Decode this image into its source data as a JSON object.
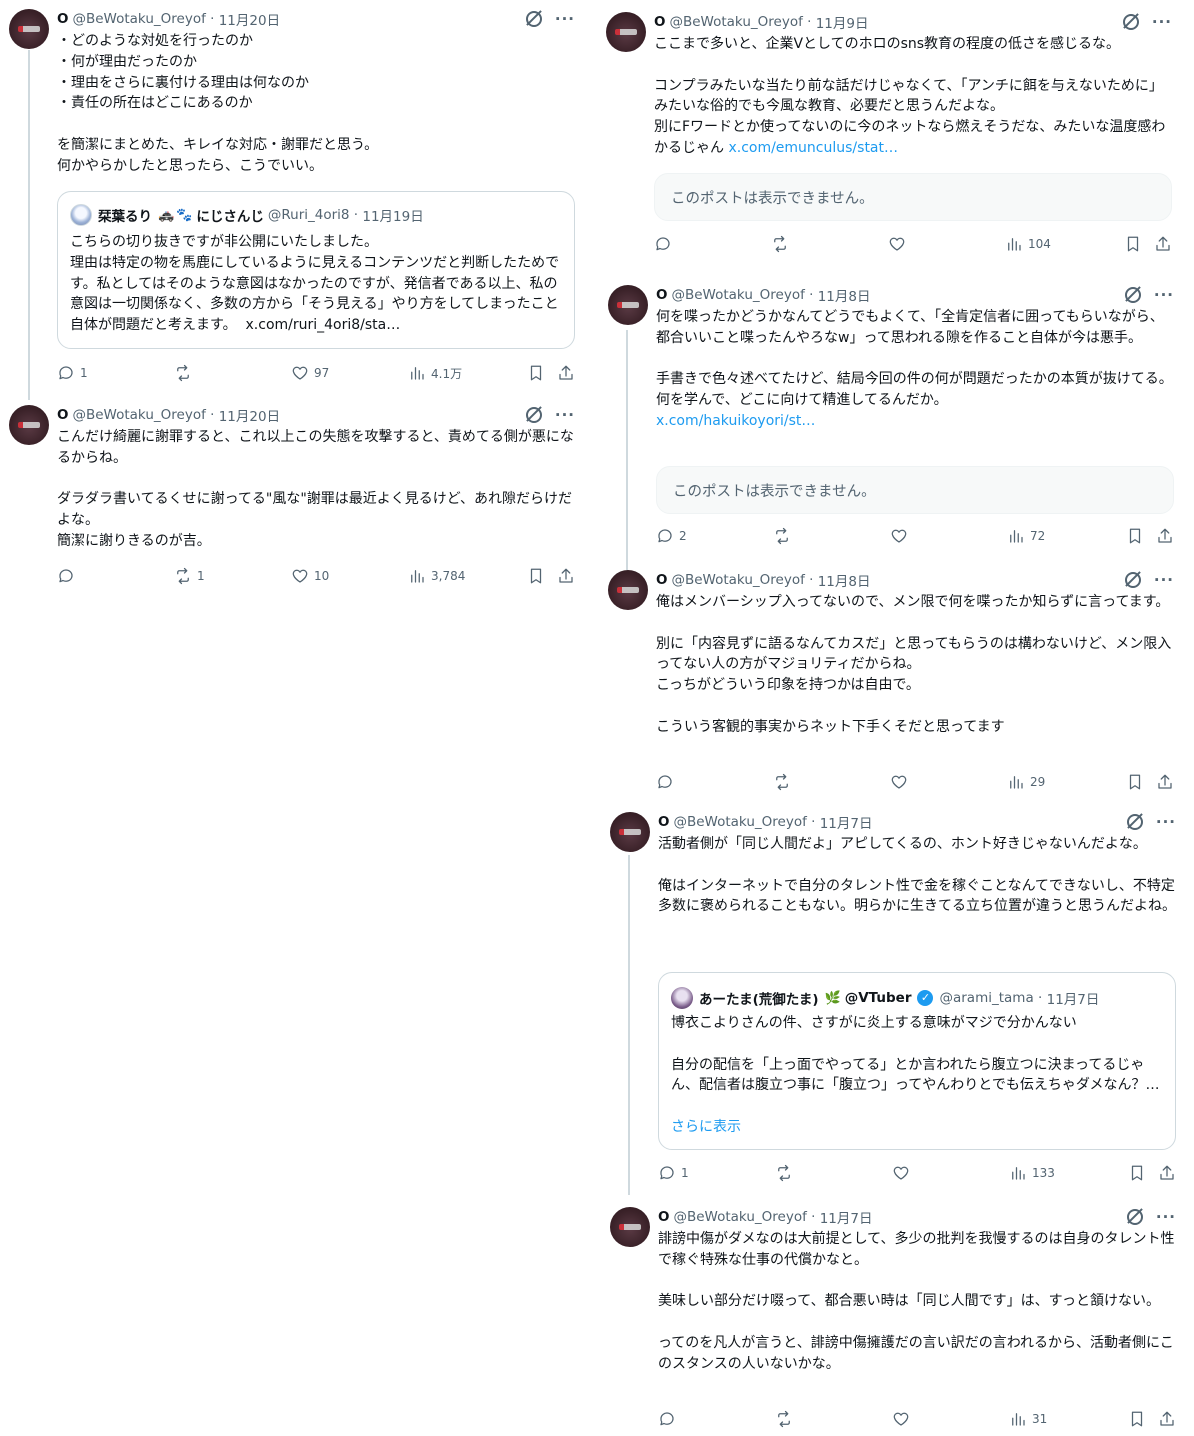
{
  "tweets": [
    {
      "id": "t1",
      "name": "O",
      "handle": "@BeWotaku_Oreyof",
      "date": "11月20日",
      "text": "・どのような対処を行ったのか\n・何が理由だったのか\n・理由をさらに裏付ける理由は何なのか\n・責任の所在はどこにあるのか\n\nを簡潔にまとめた、キレイな対応・謝罪だと思う。\n何かやらかしたと思ったら、こうでいい。",
      "quote": {
        "name": "栞葉るり",
        "name_suffix": "にじさんじ",
        "handle": "@Ruri_4ori8",
        "date": "11月19日",
        "text": "こちらの切り抜きですが非公開にいたしました。\n理由は特定の物を馬鹿にしているように見えるコンテンツだと判断したためです。私としてはそのような意図はなかったのですが、発信者である以上、私の意図は一切関係なく、多数の方から「そう見える」やり方をしてしまったこと自体が問題だと考えます。",
        "link": "x.com/ruri_4ori8/sta…"
      },
      "replies": "1",
      "retweets": "",
      "likes": "97",
      "views": "4.1万"
    },
    {
      "id": "t2",
      "name": "O",
      "handle": "@BeWotaku_Oreyof",
      "date": "11月20日",
      "text": "こんだけ綺麗に謝罪すると、これ以上この失態を攻撃すると、責めてる側が悪になるからね。\n\nダラダラ書いてるくせに謝ってる\"風な\"謝罪は最近よく見るけど、あれ隙だらけだよな。\n簡潔に謝りきるのが吉。",
      "replies": "",
      "retweets": "1",
      "likes": "10",
      "views": "3,784"
    },
    {
      "id": "t3",
      "name": "O",
      "handle": "@BeWotaku_Oreyof",
      "date": "11月9日",
      "text": "ここまで多いと、企業Vとしてのホロのsns教育の程度の低さを感じるな。\n\nコンプラみたいな当たり前な話だけじゃなくて、「アンチに餌を与えないために」みたいな俗的でも今風な教育、必要だと思うんだよな。\n別にFワードとか使ってないのに今のネットなら燃えそうだな、みたいな温度感わかるじゃん",
      "link": "x.com/emunculus/stat…",
      "unavailable": "このポストは表示できません。",
      "replies": "",
      "retweets": "",
      "likes": "",
      "views": "104"
    },
    {
      "id": "t4",
      "name": "O",
      "handle": "@BeWotaku_Oreyof",
      "date": "11月8日",
      "text": "何を喋ったかどうかなんてどうでもよくて、「全肯定信者に囲ってもらいながら、都合いいこと喋ったんやろなw」って思われる隙を作ること自体が今は悪手。\n\n手書きで色々述べてたけど、結局今回の件の何が問題だったかの本質が抜けてる。何を学んで、どこに向けて精進してるんだか。",
      "link": "x.com/hakuikoyori/st…",
      "unavailable": "このポストは表示できません。",
      "replies": "2",
      "retweets": "",
      "likes": "",
      "views": "72"
    },
    {
      "id": "t5",
      "name": "O",
      "handle": "@BeWotaku_Oreyof",
      "date": "11月8日",
      "text": "俺はメンバーシップ入ってないので、メン限で何を喋ったか知らずに言ってます。\n\n別に「内容見ずに語るなんてカスだ」と思ってもらうのは構わないけど、メン限入ってない人の方がマジョリティだからね。\nこっちがどういう印象を持つかは自由で。\n\nこういう客観的事実からネット下手くそだと思ってます",
      "replies": "",
      "retweets": "",
      "likes": "",
      "views": "29"
    },
    {
      "id": "t6",
      "name": "O",
      "handle": "@BeWotaku_Oreyof",
      "date": "11月7日",
      "text": "活動者側が「同じ人間だよ」アピしてくるの、ホント好きじゃないんだよな。\n\n俺はインターネットで自分のタレント性で金を稼ぐことなんてできないし、不特定多数に褒められることもない。明らかに生きてる立ち位置が違うと思うんだよね。",
      "quote": {
        "name": "あーたま(荒御たま)",
        "name_suffix": "@VTuber",
        "handle": "@arami_tama",
        "date": "11月7日",
        "text": "博衣こよりさんの件、さすがに炎上する意味がマジで分かんない\n\n自分の配信を「上っ面でやってる」とか言われたら腹立つに決まってるじゃん、配信者は腹立つ事に「腹立つ」ってやんわりとでも伝えちゃダメなん？…",
        "show_more": "さらに表示"
      },
      "replies": "1",
      "retweets": "",
      "likes": "",
      "views": "133"
    },
    {
      "id": "t7",
      "name": "O",
      "handle": "@BeWotaku_Oreyof",
      "date": "11月7日",
      "text": "誹謗中傷がダメなのは大前提として、多少の批判を我慢するのは自身のタレント性で稼ぐ特殊な仕事の代償かなと。\n\n美味しい部分だけ啜って、都合悪い時は「同じ人間です」は、すっと頷けない。\n\nってのを凡人が言うと、誹謗中傷擁護だの言い訳だの言われるから、活動者側にこのスタンスの人いないかな。",
      "replies": "",
      "retweets": "",
      "likes": "",
      "views": "31"
    }
  ]
}
